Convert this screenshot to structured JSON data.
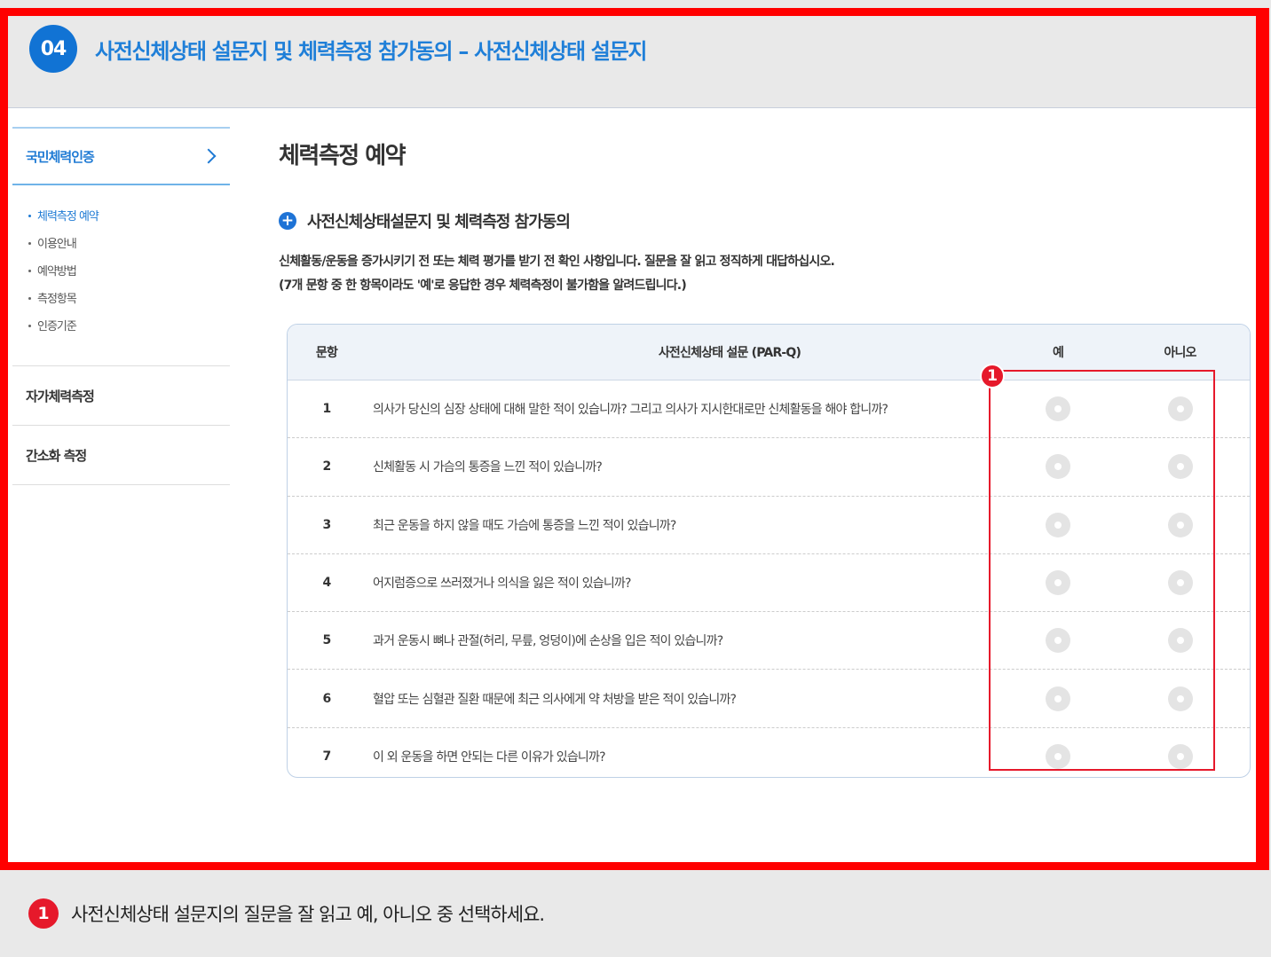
{
  "header": {
    "step": "04",
    "title": "사전신체상태 설문지 및 체력측정 참가동의 – 사전신체상태 설문지"
  },
  "sidebar": {
    "main_label": "국민체력인증",
    "sub_items": [
      {
        "label": "체력측정 예약"
      },
      {
        "label": "이용안내"
      },
      {
        "label": "예약방법"
      },
      {
        "label": "측정항목"
      },
      {
        "label": "인증기준"
      }
    ],
    "links": [
      {
        "label": "자가체력측정"
      },
      {
        "label": "간소화 측정"
      }
    ]
  },
  "main": {
    "page_title": "체력측정 예약",
    "section_title": "사전신체상태설문지 및 체력측정 참가동의",
    "desc_line1": "신체활동/운동을 증가시키기 전 또는 체력 평가를 받기 전 확인 사항입니다. 질문을 잘 읽고 정직하게 대답하십시오.",
    "desc_line2": "(7개 문항 중 한 항목이라도 '예'로 응답한 경우 체력측정이 불가함을 알려드립니다.)"
  },
  "table": {
    "headers": {
      "no": "문항",
      "question": "사전신체상태 설문 (PAR-Q)",
      "yes": "예",
      "no_answer": "아니오"
    },
    "rows": [
      {
        "no": "1",
        "question": "의사가 당신의 심장 상태에 대해 말한 적이 있습니까? 그리고 의사가 지시한대로만 신체활동을 해야 합니까?"
      },
      {
        "no": "2",
        "question": "신체활동 시 가슴의 통증을 느낀 적이 있습니까?"
      },
      {
        "no": "3",
        "question": "최근 운동을 하지 않을 때도 가슴에 통증을 느낀 적이 있습니까?"
      },
      {
        "no": "4",
        "question": "어지럼증으로 쓰러졌거나 의식을 잃은 적이 있습니까?"
      },
      {
        "no": "5",
        "question": "과거 운동시 뼈나 관절(허리, 무릎, 엉덩이)에 손상을 입은 적이 있습니까?"
      },
      {
        "no": "6",
        "question": "혈압 또는 심혈관 질환 때문에 최근 의사에게 약 처방을 받은 적이 있습니까?"
      },
      {
        "no": "7",
        "question": "이 외 운동을 하면 안되는 다른 이유가 있습니까?"
      }
    ]
  },
  "annotation": {
    "marker": "1",
    "note": "사전신체상태 설문지의 질문을 잘 읽고 예, 아니오 중 선택하세요."
  },
  "colors": {
    "accent": "#1e7ad4",
    "highlight": "#e6192b",
    "frame": "#ff0000"
  }
}
